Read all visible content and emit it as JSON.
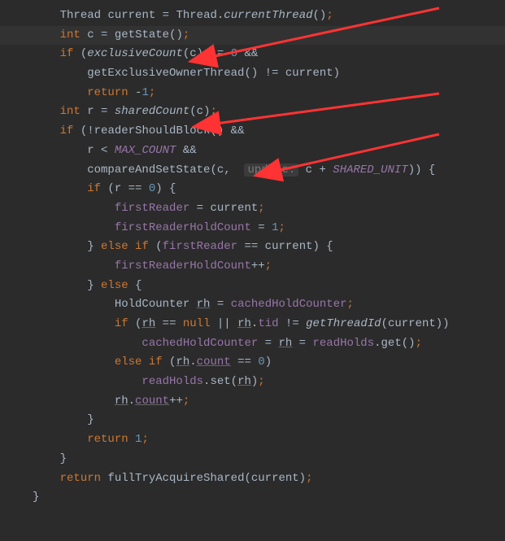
{
  "code": {
    "l1_thread": "Thread",
    "l1_var": "current",
    "l1_eq": " = ",
    "l1_cls": "Thread",
    "l1_dot": ".",
    "l1_call": "currentThread",
    "l1_paren": "()",
    "l1_semi": ";",
    "l2_kw": "int",
    "l2_sp": " ",
    "l2_var": "c",
    "l2_eq": " = ",
    "l2_call": "getState",
    "l2_paren": "()",
    "l2_semi": ";",
    "l3_kw": "if",
    "l3_sp": " (",
    "l3_call": "exclusiveCount",
    "l3_arg": "(c)",
    "l3_op": " != ",
    "l3_zero": "0",
    "l3_and": " &&",
    "l4_call": "getExclusiveOwnerThread",
    "l4_paren": "()",
    "l4_op": " != ",
    "l4_var": "current)",
    "l5_kw": "return",
    "l5_sp": " -",
    "l5_num": "1",
    "l5_semi": ";",
    "l6_kw": "int",
    "l6_sp": " ",
    "l6_var": "r",
    "l6_eq": " = ",
    "l6_call": "sharedCount",
    "l6_arg": "(c)",
    "l6_semi": ";",
    "l7_kw": "if",
    "l7_sp": " (!",
    "l7_call": "readerShouldBlock",
    "l7_paren": "()",
    "l7_and": " &&",
    "l8_var": "r",
    "l8_op": " < ",
    "l8_const": "MAX_COUNT",
    "l8_and": " &&",
    "l9_call": "compareAndSetState",
    "l9_open": "(c, ",
    "l9_hint": "update:",
    "l9_sp": " c + ",
    "l9_const": "SHARED_UNIT",
    "l9_close": ")) {",
    "l10_kw": "if",
    "l10_cond": " (r == ",
    "l10_zero": "0",
    "l10_close": ") {",
    "l11_field": "firstReader",
    "l11_eq": " = current",
    "l11_semi": ";",
    "l12_field": "firstReaderHoldCount",
    "l12_eq": " = ",
    "l12_num": "1",
    "l12_semi": ";",
    "l13_close": "} ",
    "l13_kw": "else if",
    "l13_open": " (",
    "l13_field": "firstReader",
    "l13_op": " == current) {",
    "l14_field": "firstReaderHoldCount",
    "l14_op": "++",
    "l14_semi": ";",
    "l15_close": "} ",
    "l15_kw": "else",
    "l15_open": " {",
    "l16_type": "HoldCounter ",
    "l16_var": "rh",
    "l16_eq": " = ",
    "l16_field": "cachedHoldCounter",
    "l16_semi": ";",
    "l17_kw": "if",
    "l17_open": " (",
    "l17_var": "rh",
    "l17_op": " == ",
    "l17_null": "null",
    "l17_or": " || ",
    "l17_var2": "rh",
    "l17_dot": ".",
    "l17_field": "tid",
    "l17_ne": " != ",
    "l17_call": "getThreadId",
    "l17_arg": "(current))",
    "l18_field": "cachedHoldCounter",
    "l18_eq": " = ",
    "l18_var": "rh",
    "l18_eq2": " = ",
    "l18_field2": "readHolds",
    "l18_dot": ".",
    "l18_call": "get",
    "l18_paren": "()",
    "l18_semi": ";",
    "l19_kw": "else if",
    "l19_open": " (",
    "l19_var": "rh",
    "l19_dot": ".",
    "l19_field": "count",
    "l19_op": " == ",
    "l19_zero": "0",
    "l19_close": ")",
    "l20_field": "readHolds",
    "l20_dot": ".",
    "l20_call": "set",
    "l20_open": "(",
    "l20_var": "rh",
    "l20_close": ")",
    "l20_semi": ";",
    "l21_var": "rh",
    "l21_dot": ".",
    "l21_field": "count",
    "l21_op": "++",
    "l21_semi": ";",
    "l22_close": "}",
    "l23_kw": "return",
    "l23_sp": " ",
    "l23_num": "1",
    "l23_semi": ";",
    "l24_close": "}",
    "l25_kw": "return",
    "l25_sp": " ",
    "l25_call": "fullTryAcquireShared",
    "l25_arg": "(current)",
    "l25_semi": ";",
    "l26_close": "}"
  }
}
